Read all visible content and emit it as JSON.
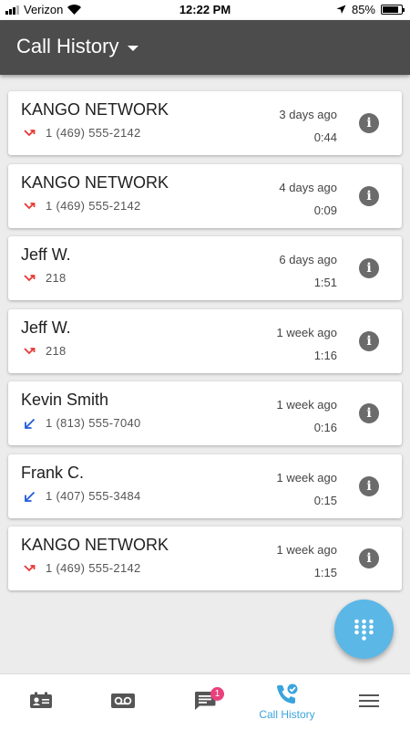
{
  "status_bar": {
    "carrier": "Verizon",
    "time": "12:22 PM",
    "battery": "85%",
    "battery_level": 0.85
  },
  "header": {
    "title": "Call History"
  },
  "colors": {
    "header_bg": "#4c4c4c",
    "accent": "#3aa4dc",
    "missed": "#e53935",
    "outgoing": "#1e5bd8",
    "badge": "#e9417c",
    "fab": "#5bb7e6"
  },
  "calls": [
    {
      "name": "KANGO NETWORK",
      "number": "1 (469) 555-2142",
      "time": "3 days ago",
      "duration": "0:44",
      "direction_icon": "missed-call-icon"
    },
    {
      "name": "KANGO NETWORK",
      "number": "1 (469) 555-2142",
      "time": "4 days ago",
      "duration": "0:09",
      "direction_icon": "missed-call-icon"
    },
    {
      "name": "Jeff W.",
      "number": "218",
      "time": "6 days ago",
      "duration": "1:51",
      "direction_icon": "missed-call-icon"
    },
    {
      "name": "Jeff W.",
      "number": "218",
      "time": "1 week ago",
      "duration": "1:16",
      "direction_icon": "missed-call-icon"
    },
    {
      "name": "Kevin Smith",
      "number": "1 (813) 555-7040",
      "time": "1 week ago",
      "duration": "0:16",
      "direction_icon": "outgoing-call-icon"
    },
    {
      "name": "Frank C.",
      "number": "1 (407) 555-3484",
      "time": "1 week ago",
      "duration": "0:15",
      "direction_icon": "outgoing-call-icon"
    },
    {
      "name": "KANGO NETWORK",
      "number": "1 (469) 555-2142",
      "time": "1 week ago",
      "duration": "1:15",
      "direction_icon": "missed-call-icon"
    }
  ],
  "info_icon": "i",
  "bottom_nav": {
    "items": [
      {
        "icon": "contacts-icon",
        "label": ""
      },
      {
        "icon": "voicemail-icon",
        "label": ""
      },
      {
        "icon": "messages-icon",
        "label": "",
        "badge": "1"
      },
      {
        "icon": "call-history-icon",
        "label": "Call History"
      },
      {
        "icon": "menu-icon",
        "label": ""
      }
    ]
  },
  "dialpad_fab": {
    "icon": "dialpad-icon"
  }
}
